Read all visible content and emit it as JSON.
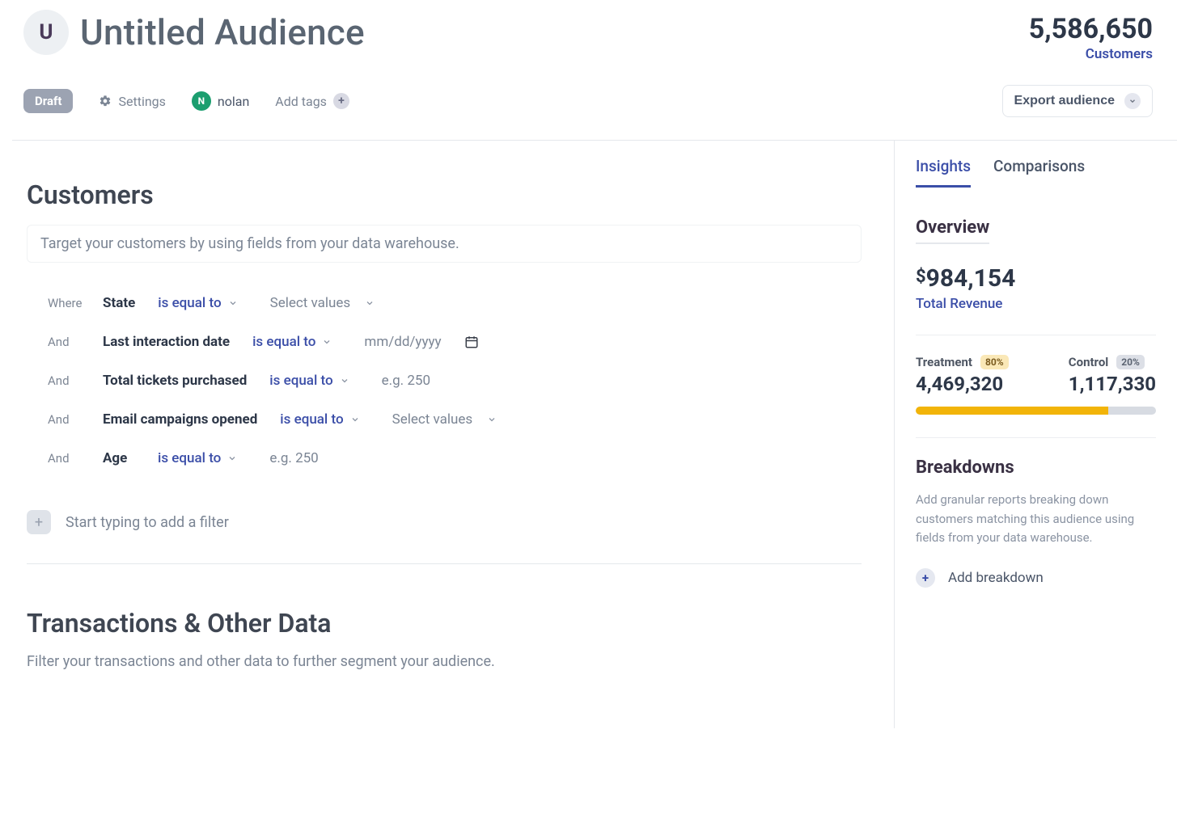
{
  "header": {
    "icon_letter": "U",
    "title": "Untitled Audience",
    "count_value": "5,586,650",
    "count_label": "Customers"
  },
  "toolbar": {
    "draft_label": "Draft",
    "settings_label": "Settings",
    "user_initial": "N",
    "user_name": "nolan",
    "add_tags_label": "Add tags",
    "export_label": "Export audience"
  },
  "customers": {
    "title": "Customers",
    "description": "Target your customers by using fields from your data warehouse.",
    "filters": [
      {
        "prefix": "Where",
        "field": "State",
        "operator": "is equal to",
        "value_type": "select",
        "value_placeholder": "Select values"
      },
      {
        "prefix": "And",
        "field": "Last interaction date",
        "operator": "is equal to",
        "value_type": "date",
        "value_placeholder": "mm/dd/yyyy"
      },
      {
        "prefix": "And",
        "field": "Total tickets purchased",
        "operator": "is equal to",
        "value_type": "number",
        "value_placeholder": "e.g. 250"
      },
      {
        "prefix": "And",
        "field": "Email campaigns opened",
        "operator": "is equal to",
        "value_type": "select",
        "value_placeholder": "Select values"
      },
      {
        "prefix": "And",
        "field": "Age",
        "operator": "is equal to",
        "value_type": "number",
        "value_placeholder": "e.g. 250"
      }
    ],
    "add_filter_label": "Start typing to add a  filter"
  },
  "transactions": {
    "title": "Transactions & Other Data",
    "description": "Filter your transactions and other data to further segment your audience."
  },
  "sidebar": {
    "tabs": {
      "insights": "Insights",
      "comparisons": "Comparisons"
    },
    "overview": {
      "heading": "Overview",
      "revenue_value": "984,154",
      "revenue_currency": "$",
      "revenue_label": "Total Revenue",
      "treatment": {
        "label": "Treatment",
        "pct": "80%",
        "value": "4,469,320"
      },
      "control": {
        "label": "Control",
        "pct": "20%",
        "value": "1,117,330"
      },
      "bar_fill_pct": 80
    },
    "breakdowns": {
      "heading": "Breakdowns",
      "description": "Add granular reports breaking down customers matching this audience using fields from your data warehouse.",
      "add_label": "Add breakdown"
    }
  }
}
